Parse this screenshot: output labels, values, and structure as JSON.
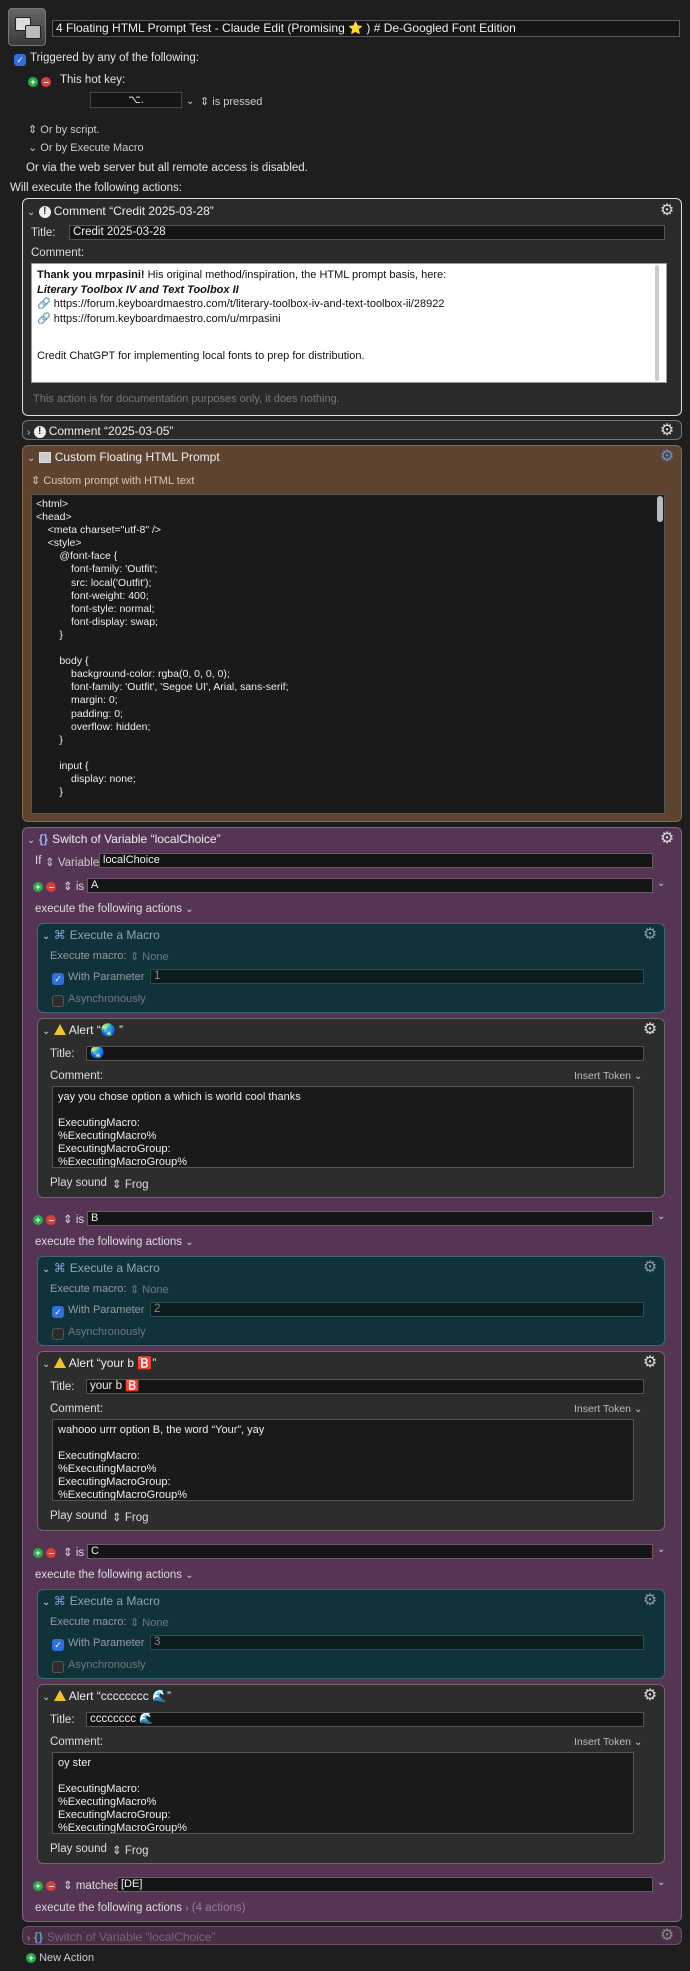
{
  "macro": {
    "title": "4 Floating HTML Prompt Test - Claude Edit (Promising ⭐️ ) # De-Googled Font Edition"
  },
  "triggers": {
    "triggered_label": "Triggered by any of the following:",
    "hotkey_label": "This hot key:",
    "hotkey_value": "⌥.",
    "hotkey_state": "is pressed",
    "or_script": "Or by script.",
    "or_execute": "Or by Execute Macro",
    "web_server": "Or via the web server but all remote access is disabled.",
    "will_execute": "Will execute the following actions:"
  },
  "comment1": {
    "header": "Comment “Credit 2025-03-28”",
    "title_label": "Title:",
    "title_value": "Credit 2025-03-28",
    "comment_label": "Comment:",
    "line1_bold": "Thank you mrpasini!",
    "line1_rest": " His original method/inspiration, the HTML prompt basis, here:",
    "line2": "Literary Toolbox IV and Text Toolbox II",
    "link1": "https://forum.keyboardmaestro.com/t/literary-toolbox-iv-and-text-toolbox-ii/28922",
    "link2": "https://forum.keyboardmaestro.com/u/mrpasini",
    "line5": "Credit ChatGPT for implementing local fonts to prep for distribution.",
    "footer": "This action is for documentation purposes only, it does nothing."
  },
  "comment2": {
    "header": "Comment “2025-03-05”"
  },
  "html_prompt": {
    "header": "Custom Floating HTML Prompt",
    "mode": "Custom prompt with HTML text",
    "code": "<html>\n<head>\n    <meta charset=\"utf-8\" />\n    <style>\n        @font-face {\n            font-family: 'Outfit';\n            src: local('Outfit');\n            font-weight: 400;\n            font-style: normal;\n            font-display: swap;\n        }\n\n        body {\n            background-color: rgba(0, 0, 0, 0);\n            font-family: 'Outfit', 'Segoe UI', Arial, sans-serif;\n            margin: 0;\n            padding: 0;\n            overflow: hidden;\n        }\n\n        input {\n            display: none;\n        }\n\n        .container {"
  },
  "switch": {
    "header": "Switch of Variable “localChoice”",
    "if_label": "If",
    "variable_label": "Variable",
    "variable_value": "localChoice",
    "execute_label": "execute the following actions",
    "cases": [
      {
        "op": "is",
        "value": "A",
        "exec_header": "Execute a Macro",
        "exec_macro_label": "Execute macro:",
        "exec_macro_value": "None",
        "with_param_label": "With Parameter",
        "param_value": "1",
        "async_label": "Asynchronously",
        "alert_header": "Alert “🌏 ”",
        "alert_title_label": "Title:",
        "alert_title": "🌏",
        "alert_comment_label": "Comment:",
        "insert_token": "Insert Token",
        "alert_text": "yay you chose option a which is world cool thanks\n\nExecutingMacro:\n%ExecutingMacro%\nExecutingMacroGroup:\n%ExecutingMacroGroup%",
        "play_sound_label": "Play sound",
        "sound": "Frog"
      },
      {
        "op": "is",
        "value": "B",
        "exec_header": "Execute a Macro",
        "exec_macro_label": "Execute macro:",
        "exec_macro_value": "None",
        "with_param_label": "With Parameter",
        "param_value": "2",
        "async_label": "Asynchronously",
        "alert_header": "Alert “your b 🅱️”",
        "alert_title_label": "Title:",
        "alert_title": "your b 🅱️",
        "alert_comment_label": "Comment:",
        "insert_token": "Insert Token",
        "alert_text": "wahooo urrr option B, the word “Your”, yay\n\nExecutingMacro:\n%ExecutingMacro%\nExecutingMacroGroup:\n%ExecutingMacroGroup%",
        "play_sound_label": "Play sound",
        "sound": "Frog"
      },
      {
        "op": "is",
        "value": "C",
        "exec_header": "Execute a Macro",
        "exec_macro_label": "Execute macro:",
        "exec_macro_value": "None",
        "with_param_label": "With Parameter",
        "param_value": "3",
        "async_label": "Asynchronously",
        "alert_header": "Alert “cccccccc 🌊”",
        "alert_title_label": "Title:",
        "alert_title": "cccccccc 🌊",
        "alert_comment_label": "Comment:",
        "insert_token": "Insert Token",
        "alert_text": "oy ster\n\nExecutingMacro:\n%ExecutingMacro%\nExecutingMacroGroup:\n%ExecutingMacroGroup%",
        "play_sound_label": "Play sound",
        "sound": "Frog"
      }
    ],
    "matches_op": "matches",
    "matches_value": "[DE]",
    "collapsed_count": "(4 actions)"
  },
  "switch2": {
    "header": "Switch of Variable “localChoice”"
  },
  "footer": {
    "new_action": "New Action"
  }
}
